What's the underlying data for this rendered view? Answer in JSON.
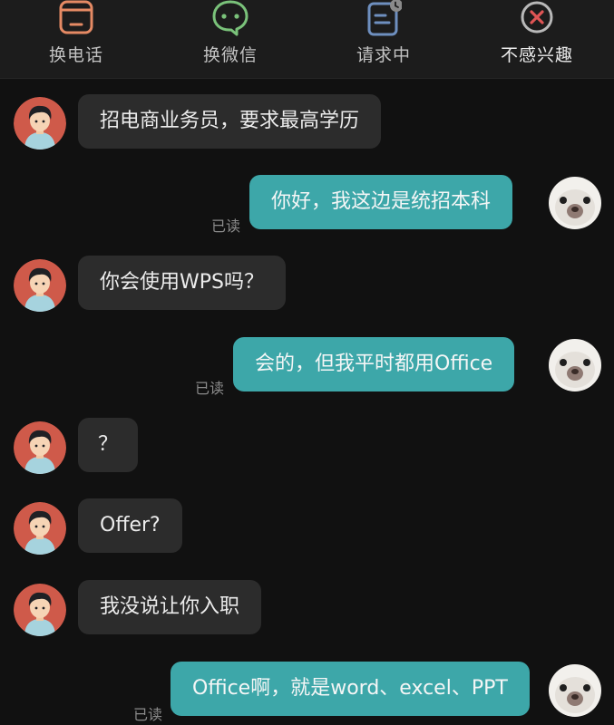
{
  "toolbar": {
    "items": [
      {
        "label": "换电话",
        "icon": "phone-icon"
      },
      {
        "label": "换微信",
        "icon": "wechat-icon"
      },
      {
        "label": "请求中",
        "icon": "resume-pending-icon"
      },
      {
        "label": "不感兴趣",
        "icon": "not-interested-icon"
      }
    ]
  },
  "colors": {
    "background": "#111111",
    "toolbar_bg": "#1c1c1c",
    "incoming_bubble": "#2c2c2c",
    "outgoing_bubble": "#3da7a9",
    "read_text": "#8b8b8b",
    "phone_icon": "#e58a64",
    "wechat_icon": "#7ac27a",
    "resume_icon": "#6e8fbf",
    "dismiss_icon": "#e05555"
  },
  "messages": [
    {
      "from": "recruiter",
      "text": "招电商业务员，要求最高学历"
    },
    {
      "from": "me",
      "text": "你好，我这边是统招本科",
      "status": "已读"
    },
    {
      "from": "recruiter",
      "text": "你会使用WPS吗？"
    },
    {
      "from": "me",
      "text": "会的，但我平时都用Office",
      "status": "已读"
    },
    {
      "from": "recruiter",
      "text": "？"
    },
    {
      "from": "recruiter",
      "text": "Offer?"
    },
    {
      "from": "recruiter",
      "text": "我没说让你入职"
    },
    {
      "from": "me",
      "text": "Office啊，就是word、excel、PPT",
      "status": "已读"
    }
  ]
}
